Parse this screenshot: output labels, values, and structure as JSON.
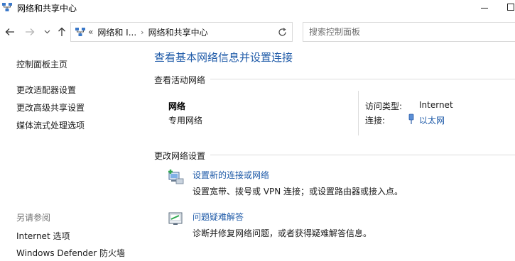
{
  "window": {
    "title": "网络和共享中心",
    "controls": {
      "minimize": "minimize",
      "maximize": "maximize"
    }
  },
  "nav": {
    "address_overflow": "«",
    "breadcrumbs": [
      "网络和 I...",
      "网络和共享中心"
    ],
    "search_placeholder": "搜索控制面板"
  },
  "sidebar": {
    "home": "控制面板主页",
    "links": [
      "更改适配器设置",
      "更改高级共享设置",
      "媒体流式处理选项"
    ],
    "see_also_title": "另请参阅",
    "see_also": [
      "Internet 选项",
      "Windows Defender 防火墙"
    ]
  },
  "main": {
    "title": "查看基本网络信息并设置连接",
    "active_section": "查看活动网络",
    "network": {
      "name": "网络",
      "type": "专用网络",
      "access_label": "访问类型:",
      "access_value": "Internet",
      "conn_label": "连接:",
      "conn_value": "以太网"
    },
    "change_section": "更改网络设置",
    "tasks": [
      {
        "title": "设置新的连接或网络",
        "desc": "设置宽带、拨号或 VPN 连接；或设置路由器或接入点。"
      },
      {
        "title": "问题疑难解答",
        "desc": "诊断并修复网络问题，或者获得疑难解答信息。"
      }
    ]
  },
  "colors": {
    "link": "#1e5aa8",
    "divider": "#dcdcdc",
    "muted": "#737373"
  }
}
